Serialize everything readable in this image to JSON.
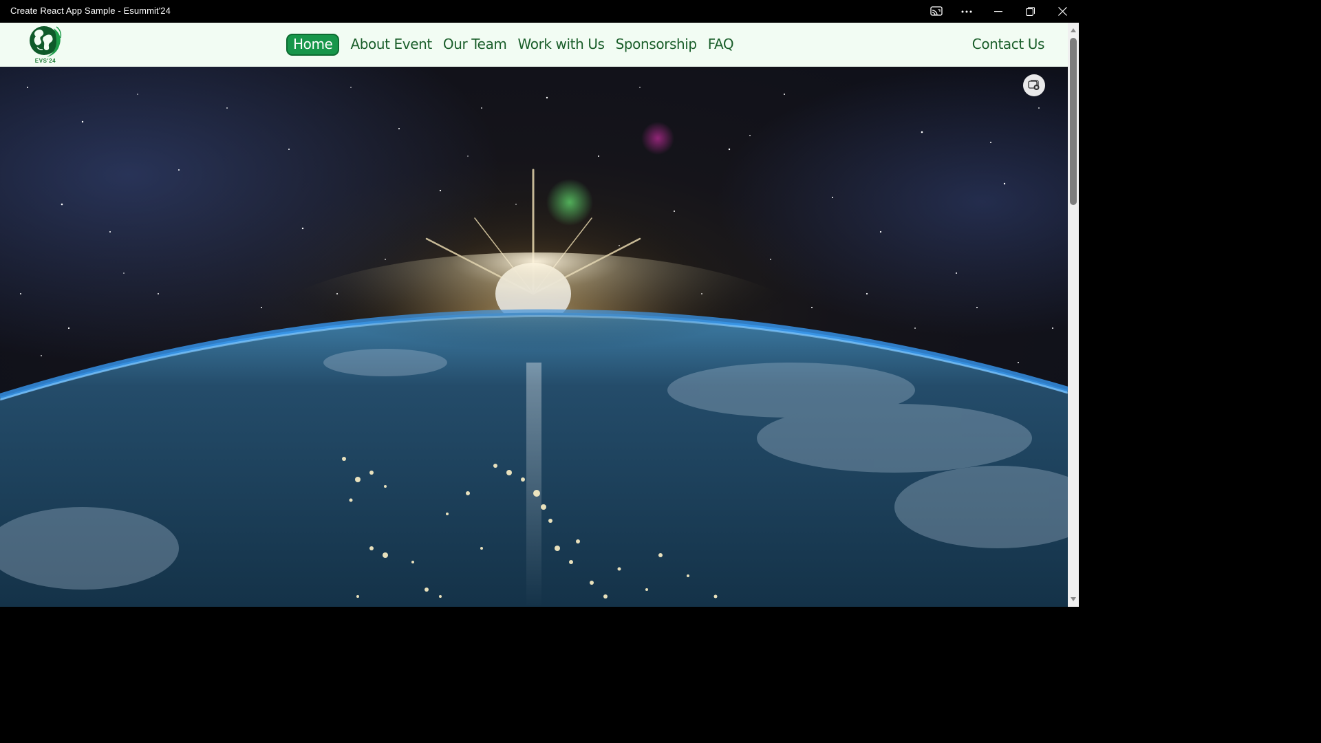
{
  "window": {
    "title": "Create React App Sample - Esummit'24"
  },
  "navbar": {
    "logo_caption": "EVS'24",
    "links": [
      {
        "label": "Home",
        "active": true
      },
      {
        "label": "About Event"
      },
      {
        "label": "Our Team"
      },
      {
        "label": "Work with Us"
      },
      {
        "label": "Sponsorship"
      },
      {
        "label": "FAQ"
      }
    ],
    "contact_label": "Contact Us"
  },
  "icons": {
    "cast": "cast-icon",
    "more": "more-options-icon",
    "minimize": "minimize-icon",
    "restore": "restore-icon",
    "close": "close-icon",
    "pip": "picture-in-picture-icon",
    "logo": "globe-logo-icon"
  },
  "colors": {
    "nav_bg": "#f2fcf3",
    "nav_text": "#1a5e2a",
    "active_bg": "#17964a",
    "titlebar_bg": "#000000"
  }
}
